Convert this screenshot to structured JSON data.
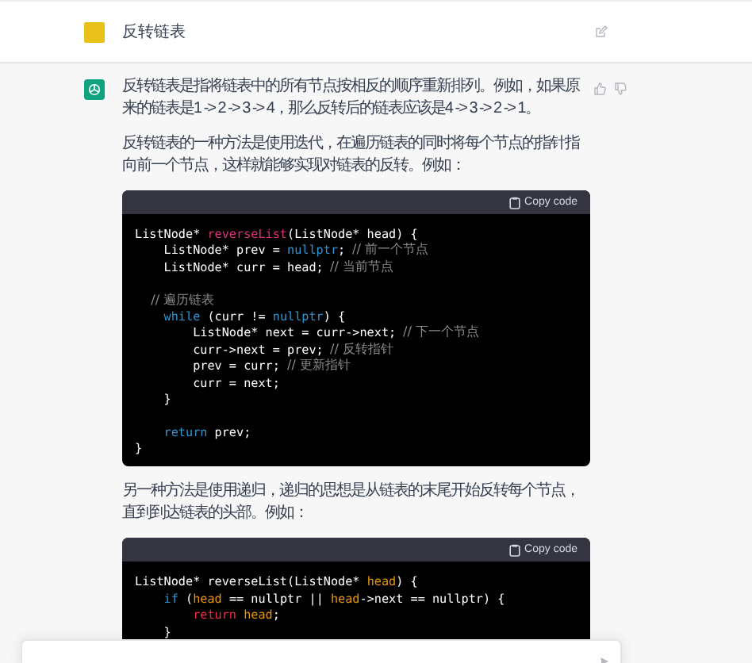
{
  "user_message": {
    "text": "反转链表"
  },
  "assistant_message": {
    "blocks": [
      {
        "kind": "paragraph",
        "text": "反转链表是指将链表中的所有节点按相反的顺序重新排列。例如，如果原来的链表是1 -> 2 -> 3 -> 4，那么反转后的链表应该是4 -> 3 -> 2 -> 1。"
      },
      {
        "kind": "paragraph",
        "text": "反转链表的一种方法是使用迭代，在遍历链表的同时将每个节点的指针指向前一个节点，这样就能够实现对链表的反转。例如："
      },
      {
        "kind": "code",
        "copy_label": "Copy code",
        "lines": [
          {
            "kind": "code",
            "tokens": [
              {
                "kind": "plain",
                "text": "ListNode* "
              },
              {
                "kind": "function",
                "text": "reverseList"
              },
              {
                "kind": "plain",
                "text": "(ListNode* head) {"
              }
            ]
          },
          {
            "kind": "code",
            "tokens": [
              {
                "kind": "plain",
                "text": "    ListNode* prev = "
              },
              {
                "kind": "keyword",
                "text": "nullptr"
              },
              {
                "kind": "plain",
                "text": "; "
              },
              {
                "kind": "comment",
                "text": "// 前一个节点"
              }
            ]
          },
          {
            "kind": "code",
            "tokens": [
              {
                "kind": "plain",
                "text": "    ListNode* curr = head; "
              },
              {
                "kind": "comment",
                "text": "// 当前节点"
              }
            ]
          },
          {
            "kind": "blank"
          },
          {
            "kind": "code",
            "tokens": [
              {
                "kind": "comment",
                "text": "    // 遍历链表"
              }
            ]
          },
          {
            "kind": "code",
            "tokens": [
              {
                "kind": "keyword",
                "text": "    while"
              },
              {
                "kind": "plain",
                "text": " (curr != "
              },
              {
                "kind": "keyword",
                "text": "nullptr"
              },
              {
                "kind": "plain",
                "text": ") {"
              }
            ]
          },
          {
            "kind": "code",
            "tokens": [
              {
                "kind": "plain",
                "text": "        ListNode* next = curr->next; "
              },
              {
                "kind": "comment",
                "text": "// 下一个节点"
              }
            ]
          },
          {
            "kind": "code",
            "tokens": [
              {
                "kind": "plain",
                "text": "        curr->next = prev; "
              },
              {
                "kind": "comment",
                "text": "// 反转指针"
              }
            ]
          },
          {
            "kind": "code",
            "tokens": [
              {
                "kind": "plain",
                "text": "        prev = curr; "
              },
              {
                "kind": "comment",
                "text": "// 更新指针"
              }
            ]
          },
          {
            "kind": "code",
            "tokens": [
              {
                "kind": "plain",
                "text": "        curr = next;"
              }
            ]
          },
          {
            "kind": "code",
            "tokens": [
              {
                "kind": "plain",
                "text": "    }"
              }
            ]
          },
          {
            "kind": "blank"
          },
          {
            "kind": "code",
            "tokens": [
              {
                "kind": "keyword",
                "text": "    return"
              },
              {
                "kind": "plain",
                "text": " prev;"
              }
            ]
          },
          {
            "kind": "code",
            "tokens": [
              {
                "kind": "plain",
                "text": "}"
              }
            ]
          }
        ]
      },
      {
        "kind": "paragraph",
        "text": "另一种方法是使用递归，递归的思想是从链表的末尾开始反转每个节点，直到到达链表的头部。例如："
      },
      {
        "kind": "code",
        "copy_label": "Copy code",
        "lines": [
          {
            "kind": "code",
            "tokens": [
              {
                "kind": "plain",
                "text": "ListNode* reverseList(ListNode* "
              },
              {
                "kind": "variable",
                "text": "head"
              },
              {
                "kind": "plain",
                "text": ") {"
              }
            ]
          },
          {
            "kind": "code",
            "tokens": [
              {
                "kind": "keyword",
                "text": "    if"
              },
              {
                "kind": "plain",
                "text": " ("
              },
              {
                "kind": "variable",
                "text": "head"
              },
              {
                "kind": "plain",
                "text": " == nullptr || "
              },
              {
                "kind": "variable",
                "text": "head"
              },
              {
                "kind": "plain",
                "text": "->next == nullptr) {"
              }
            ]
          },
          {
            "kind": "code",
            "tokens": [
              {
                "kind": "control",
                "text": "        return "
              },
              {
                "kind": "variable",
                "text": "head"
              },
              {
                "kind": "plain",
                "text": ";"
              }
            ]
          },
          {
            "kind": "code",
            "tokens": [
              {
                "kind": "plain",
                "text": "    }"
              }
            ]
          }
        ]
      }
    ]
  }
}
